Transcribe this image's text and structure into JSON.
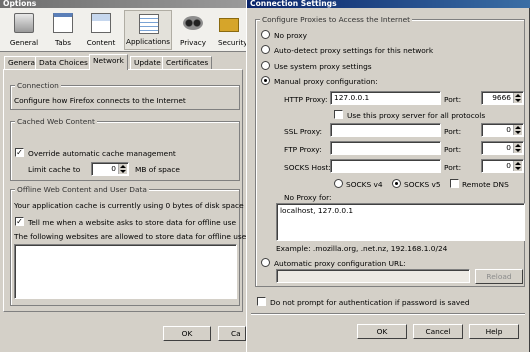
{
  "options": {
    "title": "Options",
    "toolbar": [
      {
        "label": "General",
        "icon": "switch-icon"
      },
      {
        "label": "Tabs",
        "icon": "tabs-icon"
      },
      {
        "label": "Content",
        "icon": "content-icon"
      },
      {
        "label": "Applications",
        "icon": "applications-icon"
      },
      {
        "label": "Privacy",
        "icon": "mask-icon"
      },
      {
        "label": "Security",
        "icon": "padlock-icon"
      }
    ],
    "tabs": [
      "General",
      "Data Choices",
      "Network",
      "Update",
      "Certificates"
    ],
    "selected_tab": "Network",
    "connection": {
      "heading": "Connection",
      "text": "Configure how Firefox connects to the Internet"
    },
    "cache": {
      "heading": "Cached Web Content",
      "override_label": "Override automatic cache management",
      "override_checked": true,
      "limit_label": "Limit cache to",
      "limit_value": "0",
      "limit_unit": "MB of space"
    },
    "offline": {
      "heading": "Offline Web Content and User Data",
      "usage_text": "Your application cache is currently using 0 bytes of disk space",
      "tell_label": "Tell me when a website asks to store data for offline use",
      "tell_checked": true,
      "allowed_text": "The following websites are allowed to store data for offline use:"
    },
    "ok_label": "OK",
    "cancel_label": "Ca"
  },
  "conn": {
    "title": "Connection Settings",
    "group_label": "Configure Proxies to Access the Internet",
    "options": [
      "No proxy",
      "Auto-detect proxy settings for this network",
      "Use system proxy settings",
      "Manual proxy configuration:"
    ],
    "selected_option": 3,
    "http": {
      "label": "HTTP Proxy:",
      "value": "127.0.0.1",
      "port_label": "Port:",
      "port": "9666"
    },
    "use_all_label": "Use this proxy server for all protocols",
    "use_all_checked": false,
    "ssl": {
      "label": "SSL Proxy:",
      "value": "",
      "port_label": "Port:",
      "port": "0"
    },
    "ftp": {
      "label": "FTP Proxy:",
      "value": "",
      "port_label": "Port:",
      "port": "0"
    },
    "socks": {
      "label": "SOCKS Host:",
      "value": "",
      "port_label": "Port:",
      "port": "0"
    },
    "socks_v4": "SOCKS v4",
    "socks_v5": "SOCKS v5",
    "socks_selected": "v5",
    "remote_dns_label": "Remote DNS",
    "remote_dns_checked": false,
    "no_proxy_label": "No Proxy for:",
    "no_proxy_value": "localhost, 127.0.0.1",
    "example": "Example: .mozilla.org, .net.nz, 192.168.1.0/24",
    "auto_url_label": "Automatic proxy configuration URL:",
    "auto_url_value": "",
    "reload_label": "Reload",
    "no_prompt_label": "Do not prompt for authentication if password is saved",
    "no_prompt_checked": false,
    "ok_label": "OK",
    "cancel_label": "Cancel",
    "help_label": "Help"
  }
}
